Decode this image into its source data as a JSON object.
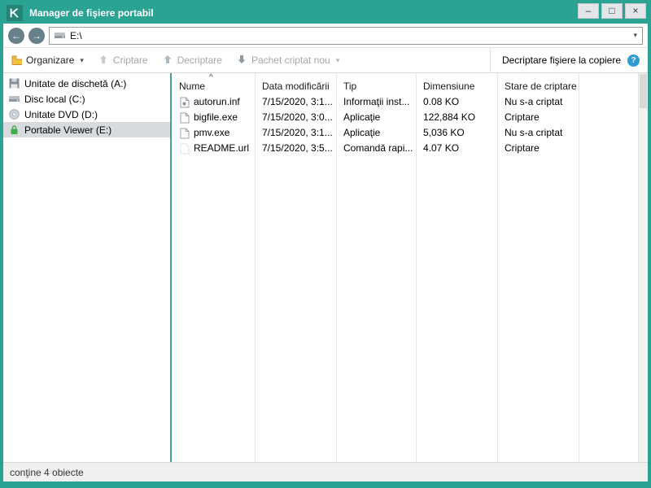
{
  "colors": {
    "titlebar": "#2aa392",
    "window_border": "#2aa392",
    "selected_item_bg": "#d7dbdd",
    "sidebar_divider": "#45a393",
    "help_icon": "#2e9ad6",
    "lock_icon": "#3fae49",
    "folder_icon": "#f3c13f",
    "disabled_text": "#a6a6a6"
  },
  "window": {
    "title": "Manager de fişiere portabil",
    "controls": {
      "minimize": "–",
      "maximize": "□",
      "close": "×"
    }
  },
  "nav": {
    "back_glyph": "←",
    "forward_glyph": "→",
    "address": "E:\\",
    "dropdown_glyph": "▾"
  },
  "toolbar": {
    "organize_label": "Organizare",
    "organize_caret": "▾",
    "encrypt_label": "Criptare",
    "decrypt_label": "Decriptare",
    "new_package_label": "Pachet criptat nou",
    "new_package_caret": "▾",
    "decrypt_on_copy_label": "Decriptare fişiere la copiere",
    "help_glyph": "?"
  },
  "sidebar": {
    "items": [
      {
        "label": "Unitate de dischetă (A:)",
        "icon": "floppy-drive-icon",
        "selected": false
      },
      {
        "label": "Disc local (C:)",
        "icon": "hard-disk-icon",
        "selected": false
      },
      {
        "label": "Unitate DVD (D:)",
        "icon": "dvd-drive-icon",
        "selected": false
      },
      {
        "label": "Portable Viewer (E:)",
        "icon": "lock-icon",
        "selected": true
      }
    ]
  },
  "file_list": {
    "sort_indicator": "^",
    "columns": [
      "Nume",
      "Data modificării",
      "Tip",
      "Dimensiune",
      "Stare de criptare"
    ],
    "rows": [
      {
        "name": "autorun.inf",
        "modified": "7/15/2020, 3:1...",
        "type": "Informaţii inst...",
        "size": "0.08 KO",
        "encryption": "Nu s-a criptat"
      },
      {
        "name": "bigfile.exe",
        "modified": "7/15/2020, 3:0...",
        "type": "Aplicaţie",
        "size": "122,884 KO",
        "encryption": "Criptare"
      },
      {
        "name": "pmv.exe",
        "modified": "7/15/2020, 3:1...",
        "type": "Aplicaţie",
        "size": "5,036 KO",
        "encryption": "Nu s-a criptat"
      },
      {
        "name": "README.url",
        "modified": "7/15/2020, 3:5...",
        "type": "Comandă rapi...",
        "size": "4.07 KO",
        "encryption": "Criptare"
      }
    ]
  },
  "status_bar": {
    "text": "conţine 4 obiecte"
  }
}
